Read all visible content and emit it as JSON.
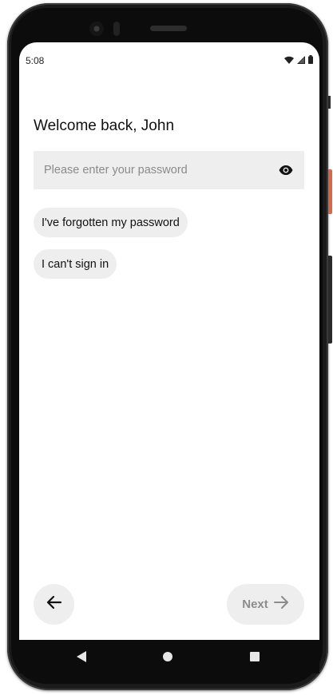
{
  "status_bar": {
    "time": "5:08",
    "icons": [
      "wifi-icon",
      "cellular-signal-icon",
      "battery-icon"
    ]
  },
  "title": "Welcome back, John",
  "password": {
    "placeholder": "Please enter your password",
    "value": "",
    "toggle_icon": "eye-icon"
  },
  "links": {
    "forgot": "I've forgotten my password",
    "cant_sign_in": "I can't sign in"
  },
  "footer": {
    "back_icon": "arrow-left-icon",
    "next_label": "Next",
    "next_icon": "arrow-right-icon",
    "next_enabled": false
  },
  "nav_bar": {
    "buttons": [
      "nav-back-icon",
      "nav-home-icon",
      "nav-recents-icon"
    ]
  },
  "colors": {
    "surface": "#eeeeee",
    "text": "#111111",
    "placeholder": "#8a8a8a",
    "disabled_text": "#8c8c8c",
    "device_frame": "#1b1b1b",
    "side_button_accent": "#d4694a"
  }
}
